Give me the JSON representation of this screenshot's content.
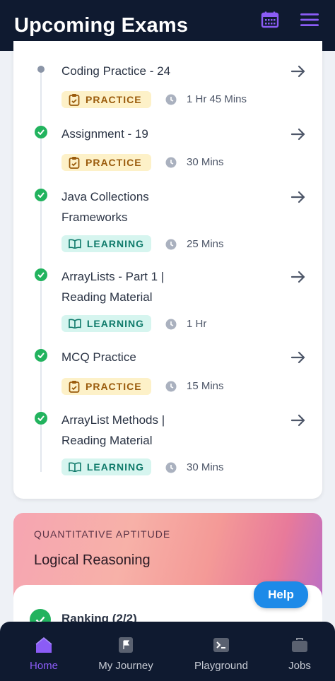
{
  "header": {
    "title": "Upcoming Exams",
    "calendar_icon": "calendar-icon",
    "menu_icon": "menu-icon",
    "accent": "#8b5cf6"
  },
  "timeline": {
    "items": [
      {
        "title": "Coding Practice - 24",
        "status": "pending",
        "badge": "PRACTICE",
        "badge_type": "practice",
        "duration": "1 Hr 45 Mins"
      },
      {
        "title": "Assignment - 19",
        "status": "done",
        "badge": "PRACTICE",
        "badge_type": "practice",
        "duration": "30 Mins"
      },
      {
        "title": "Java Collections Frameworks",
        "status": "done",
        "badge": "LEARNING",
        "badge_type": "learning",
        "duration": "25 Mins"
      },
      {
        "title": "ArrayLists - Part 1  | Reading Material",
        "status": "done",
        "badge": "LEARNING",
        "badge_type": "learning",
        "duration": "1 Hr"
      },
      {
        "title": "MCQ Practice",
        "status": "done",
        "badge": "PRACTICE",
        "badge_type": "practice",
        "duration": "15 Mins"
      },
      {
        "title": "ArrayList Methods | Reading Material",
        "status": "done",
        "badge": "LEARNING",
        "badge_type": "learning",
        "duration": "30 Mins"
      }
    ]
  },
  "course_card": {
    "category": "QUANTITATIVE APTITUDE",
    "title": "Logical Reasoning",
    "ranking": "Ranking (2/2)"
  },
  "help": {
    "label": "Help"
  },
  "bottom_nav": {
    "items": [
      {
        "label": "Home",
        "icon": "home-icon",
        "active": true
      },
      {
        "label": "My Journey",
        "icon": "flag-icon",
        "active": false
      },
      {
        "label": "Playground",
        "icon": "terminal-icon",
        "active": false
      },
      {
        "label": "Jobs",
        "icon": "briefcase-icon",
        "active": false
      }
    ]
  }
}
